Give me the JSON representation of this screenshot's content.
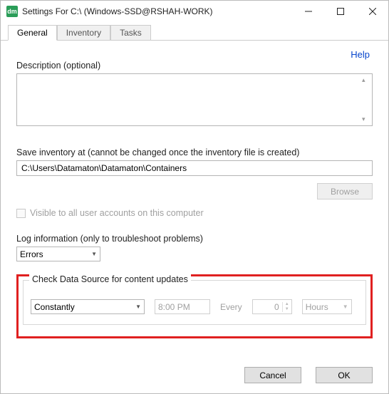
{
  "window": {
    "title": "Settings For C:\\ (Windows-SSD@RSHAH-WORK)"
  },
  "tabs": {
    "general": "General",
    "inventory": "Inventory",
    "tasks": "Tasks"
  },
  "help": "Help",
  "labels": {
    "description": "Description (optional)",
    "save_inventory": "Save inventory at  (cannot be changed once the inventory file is created)",
    "visible_all": "Visible to all user accounts on this computer",
    "log_info": "Log information (only to troubleshoot problems)",
    "check_updates": "Check Data Source for content updates",
    "every": "Every"
  },
  "values": {
    "path": "C:\\Users\\Datamaton\\Datamaton\\Containers",
    "log_level": "Errors",
    "freq": "Constantly",
    "time": "8:00 PM",
    "num": "0",
    "unit": "Hours"
  },
  "buttons": {
    "browse": "Browse",
    "cancel": "Cancel",
    "ok": "OK"
  }
}
